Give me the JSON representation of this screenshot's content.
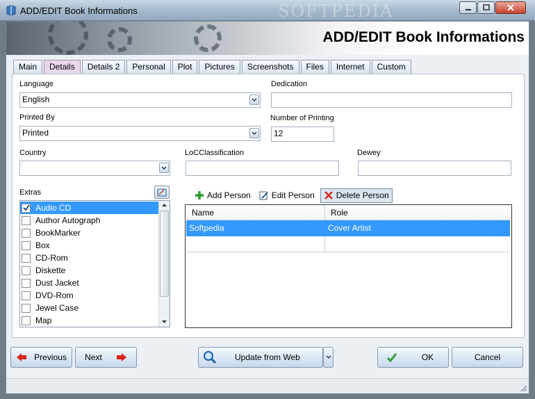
{
  "window": {
    "title": "ADD/EDIT Book Informations",
    "watermark": "SOFTPEDIA",
    "controls": {
      "minimize": "minimize",
      "maximize": "maximize",
      "close": "close"
    }
  },
  "banner": {
    "title": "ADD/EDIT Book Informations"
  },
  "tabs": [
    {
      "label": "Main"
    },
    {
      "label": "Details",
      "active": true
    },
    {
      "label": "Details 2"
    },
    {
      "label": "Personal"
    },
    {
      "label": "Plot"
    },
    {
      "label": "Pictures"
    },
    {
      "label": "Screenshots"
    },
    {
      "label": "Files"
    },
    {
      "label": "Internet"
    },
    {
      "label": "Custom"
    }
  ],
  "form": {
    "language": {
      "label": "Language",
      "value": "English"
    },
    "dedication": {
      "label": "Dedication",
      "value": ""
    },
    "printed_by": {
      "label": "Printed By",
      "value": "Printed"
    },
    "number_of_printing": {
      "label": "Number of Printing",
      "value": "12"
    },
    "country": {
      "label": "Country",
      "value": ""
    },
    "loc_classification": {
      "label": "LoCClassification",
      "value": ""
    },
    "dewey": {
      "label": "Dewey",
      "value": ""
    }
  },
  "extras": {
    "label": "Extras",
    "items": [
      {
        "label": "Audio CD",
        "checked": true,
        "selected": true
      },
      {
        "label": "Author Autograph",
        "checked": false
      },
      {
        "label": "BookMarker",
        "checked": false
      },
      {
        "label": "Box",
        "checked": false
      },
      {
        "label": "CD-Rom",
        "checked": false
      },
      {
        "label": "Diskette",
        "checked": false
      },
      {
        "label": "Dust Jacket",
        "checked": false
      },
      {
        "label": "DVD-Rom",
        "checked": false
      },
      {
        "label": "Jewel Case",
        "checked": false
      },
      {
        "label": "Map",
        "checked": false
      }
    ]
  },
  "persons": {
    "toolbar": {
      "add": "Add Person",
      "edit": "Edit Person",
      "delete": "Delete Person"
    },
    "columns": [
      "Name",
      "Role"
    ],
    "rows": [
      {
        "name": "Softpedia",
        "role": "Cover Artist",
        "selected": true
      },
      {
        "name": "",
        "role": ""
      }
    ]
  },
  "buttons": {
    "previous": "Previous",
    "next": "Next",
    "update_from_web": "Update from Web",
    "ok": "OK",
    "cancel": "Cancel"
  },
  "colors": {
    "selection": "#3399ff",
    "accent_red": "#d9261c",
    "accent_green": "#2e9b2e"
  }
}
